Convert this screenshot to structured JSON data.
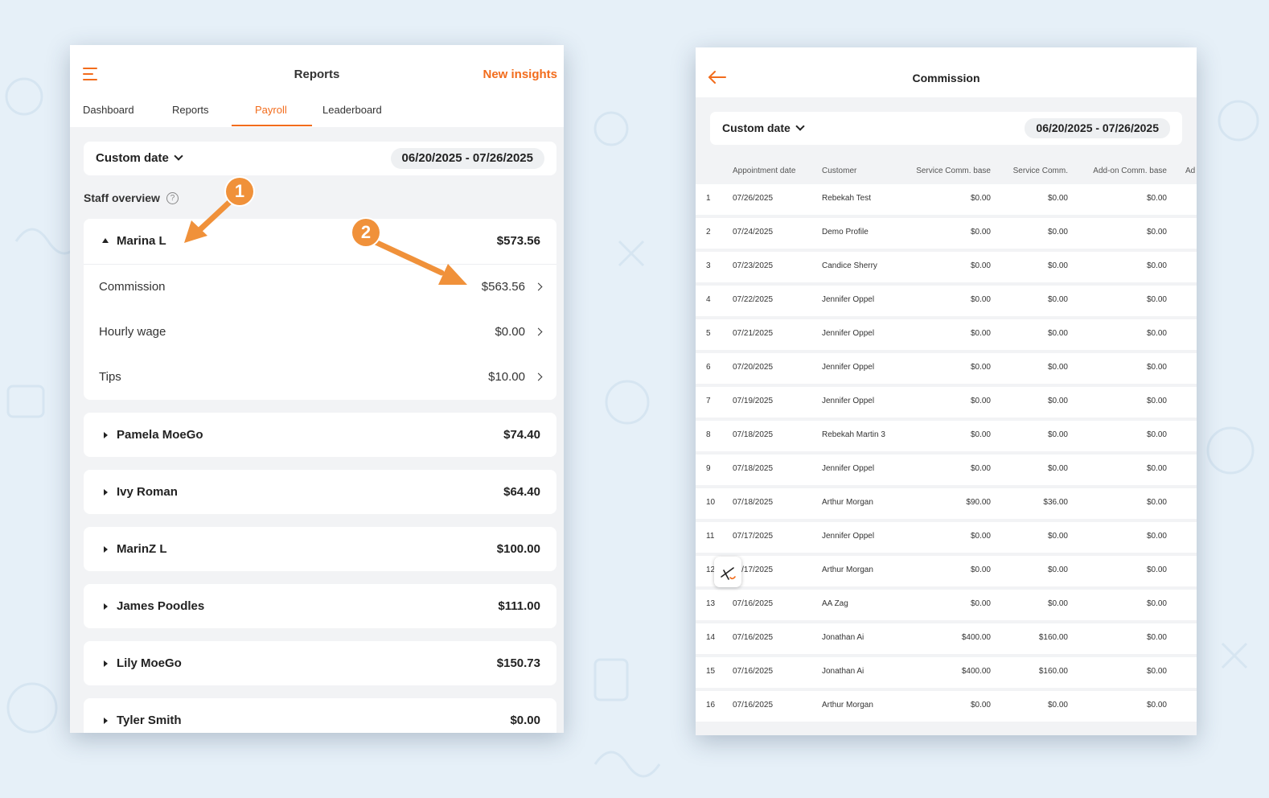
{
  "reports_screen": {
    "title": "Reports",
    "new_insights": "New insights",
    "tabs": [
      {
        "label": "Dashboard",
        "active": false
      },
      {
        "label": "Reports",
        "active": false
      },
      {
        "label": "Payroll",
        "active": true
      },
      {
        "label": "Leaderboard",
        "active": false
      }
    ],
    "date_filter": {
      "label": "Custom date",
      "range": "06/20/2025 - 07/26/2025"
    },
    "staff_overview_label": "Staff overview",
    "staff": [
      {
        "name": "Marina L",
        "total": "$573.56",
        "expanded": true,
        "breakdown": [
          {
            "label": "Commission",
            "amount": "$563.56"
          },
          {
            "label": "Hourly wage",
            "amount": "$0.00"
          },
          {
            "label": "Tips",
            "amount": "$10.00"
          }
        ]
      },
      {
        "name": "Pamela MoeGo",
        "total": "$74.40",
        "expanded": false
      },
      {
        "name": "Ivy Roman",
        "total": "$64.40",
        "expanded": false
      },
      {
        "name": "MarinZ L",
        "total": "$100.00",
        "expanded": false
      },
      {
        "name": "James Poodles",
        "total": "$111.00",
        "expanded": false
      },
      {
        "name": "Lily MoeGo",
        "total": "$150.73",
        "expanded": false
      },
      {
        "name": "Tyler Smith",
        "total": "$0.00",
        "expanded": false
      }
    ],
    "annotations": [
      "1",
      "2"
    ]
  },
  "commission_screen": {
    "title": "Commission",
    "date_filter": {
      "label": "Custom date",
      "range": "06/20/2025 - 07/26/2025"
    },
    "columns": [
      "Appointment date",
      "Customer",
      "Service Comm. base",
      "Service Comm.",
      "Add-on Comm. base",
      "Ad"
    ],
    "rows": [
      [
        "1",
        "07/26/2025",
        "Rebekah Test",
        "$0.00",
        "$0.00",
        "$0.00"
      ],
      [
        "2",
        "07/24/2025",
        "Demo Profile",
        "$0.00",
        "$0.00",
        "$0.00"
      ],
      [
        "3",
        "07/23/2025",
        "Candice Sherry",
        "$0.00",
        "$0.00",
        "$0.00"
      ],
      [
        "4",
        "07/22/2025",
        "Jennifer Oppel",
        "$0.00",
        "$0.00",
        "$0.00"
      ],
      [
        "5",
        "07/21/2025",
        "Jennifer Oppel",
        "$0.00",
        "$0.00",
        "$0.00"
      ],
      [
        "6",
        "07/20/2025",
        "Jennifer Oppel",
        "$0.00",
        "$0.00",
        "$0.00"
      ],
      [
        "7",
        "07/19/2025",
        "Jennifer Oppel",
        "$0.00",
        "$0.00",
        "$0.00"
      ],
      [
        "8",
        "07/18/2025",
        "Rebekah Martin 3",
        "$0.00",
        "$0.00",
        "$0.00"
      ],
      [
        "9",
        "07/18/2025",
        "Jennifer Oppel",
        "$0.00",
        "$0.00",
        "$0.00"
      ],
      [
        "10",
        "07/18/2025",
        "Arthur Morgan",
        "$90.00",
        "$36.00",
        "$0.00"
      ],
      [
        "11",
        "07/17/2025",
        "Jennifer Oppel",
        "$0.00",
        "$0.00",
        "$0.00"
      ],
      [
        "12",
        "07/17/2025",
        "Arthur Morgan",
        "$0.00",
        "$0.00",
        "$0.00"
      ],
      [
        "13",
        "07/16/2025",
        "AA Zag",
        "$0.00",
        "$0.00",
        "$0.00"
      ],
      [
        "14",
        "07/16/2025",
        "Jonathan Ai",
        "$400.00",
        "$160.00",
        "$0.00"
      ],
      [
        "15",
        "07/16/2025",
        "Jonathan Ai",
        "$400.00",
        "$160.00",
        "$0.00"
      ],
      [
        "16",
        "07/16/2025",
        "Arthur Morgan",
        "$0.00",
        "$0.00",
        "$0.00"
      ]
    ]
  },
  "colors": {
    "accent": "#f26c1c",
    "annotation": "#f0913a",
    "background": "#e6f0f8"
  },
  "icons": [
    "menu-icon",
    "help-icon",
    "back-arrow-icon",
    "chevron-down-icon",
    "chevron-right-icon",
    "triangle-up-icon",
    "triangle-right-icon",
    "scissors-badge-icon"
  ]
}
